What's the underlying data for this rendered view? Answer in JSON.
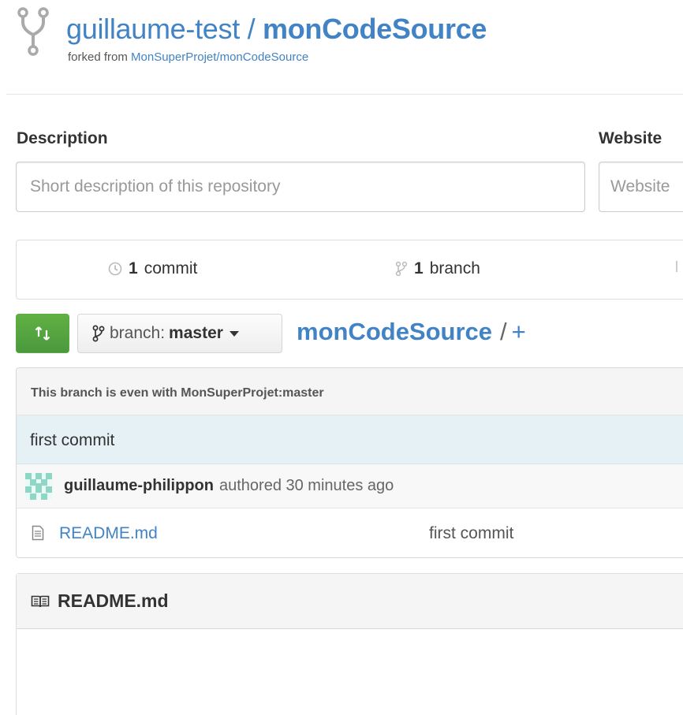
{
  "repo": {
    "owner": "guillaume-test",
    "separator": "/",
    "name": "monCodeSource",
    "forked_prefix": "forked from",
    "forked_source": "MonSuperProjet/monCodeSource"
  },
  "edit": {
    "description_label": "Description",
    "description_placeholder": "Short description of this repository",
    "website_label": "Website",
    "website_placeholder": "Website"
  },
  "numbers": {
    "commits_count": "1",
    "commits_label": "commit",
    "branches_count": "1",
    "branches_label": "branch"
  },
  "nav": {
    "branch_prefix": "branch:",
    "branch_name": "master",
    "breadcrumb_root": "monCodeSource",
    "breadcrumb_sep": "/",
    "breadcrumb_add": "+"
  },
  "commit": {
    "tease": "This branch is even with MonSuperProjet:master",
    "message": "first commit",
    "author": "guillaume-philippon",
    "authored_text": "authored 30 minutes ago"
  },
  "files": [
    {
      "name": "README.md",
      "message": "first commit"
    }
  ],
  "readme": {
    "title": "README.md"
  },
  "icons": {
    "fork": "fork-icon",
    "commits": "history-icon",
    "branches": "git-branch-icon",
    "compare": "compare-icon",
    "file": "file-text-icon",
    "readme": "book-icon"
  },
  "colors": {
    "link": "#4183c4",
    "compare_button": "#60b044",
    "commit_title_bg": "#e6f1f6"
  }
}
